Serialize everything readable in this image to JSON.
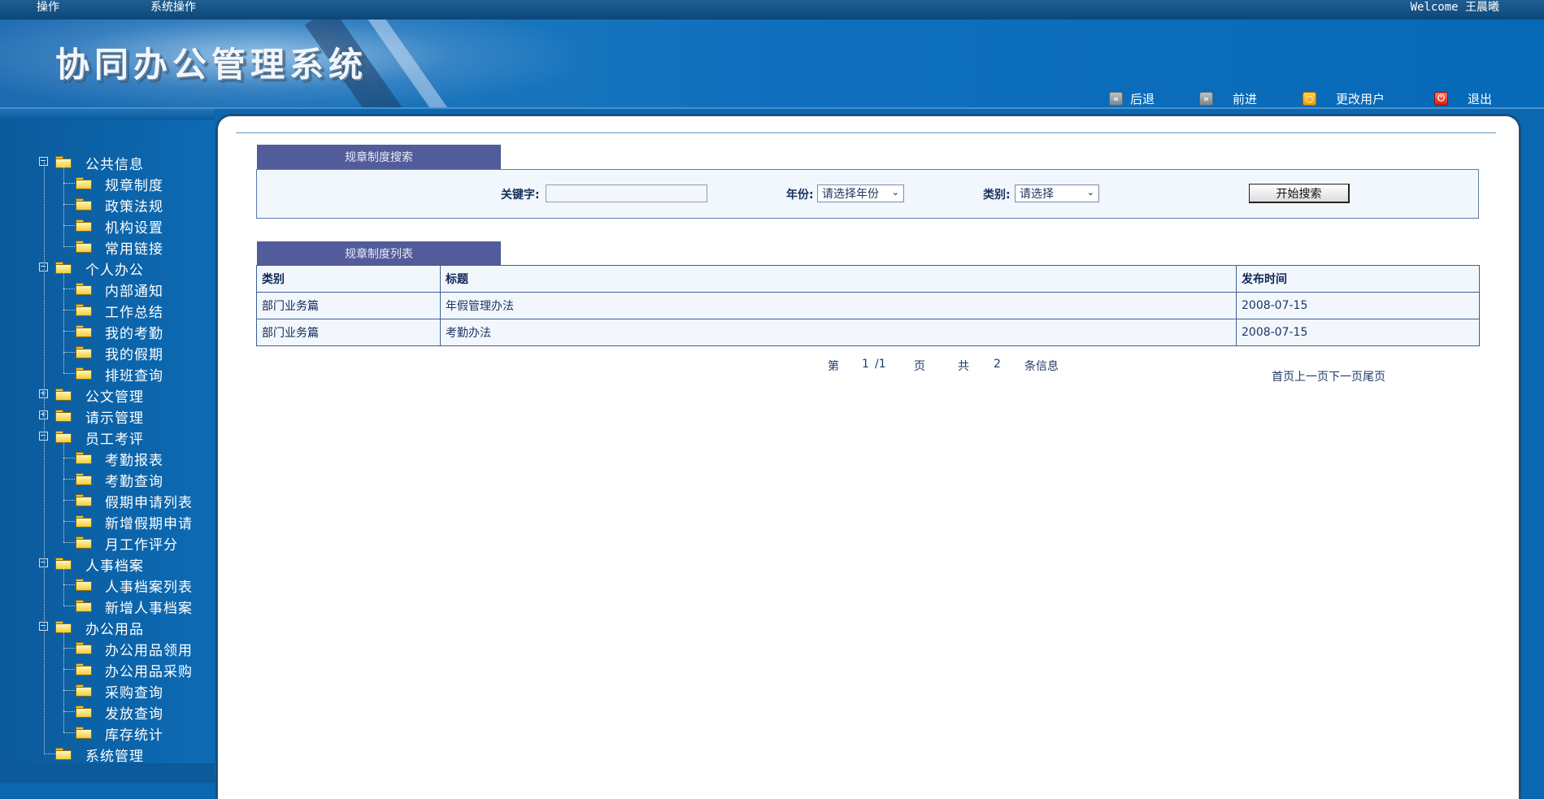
{
  "topbar": {
    "item1": "操作",
    "item2": "系统操作",
    "welcome": "Welcome  王晨曦"
  },
  "banner": {
    "title": "协同办公管理系统"
  },
  "toolbar": {
    "back": "后退",
    "forward": "前进",
    "change_user": "更改用户",
    "logout": "退出"
  },
  "sidebar": {
    "groups": [
      {
        "label": "公共信息",
        "expanded": true,
        "items": [
          "规章制度",
          "政策法规",
          "机构设置",
          "常用链接"
        ]
      },
      {
        "label": "个人办公",
        "expanded": true,
        "items": [
          "内部通知",
          "工作总结",
          "我的考勤",
          "我的假期",
          "排班查询"
        ]
      },
      {
        "label": "公文管理",
        "expanded": false,
        "items": []
      },
      {
        "label": "请示管理",
        "expanded": false,
        "items": []
      },
      {
        "label": "员工考评",
        "expanded": true,
        "items": [
          "考勤报表",
          "考勤查询",
          "假期申请列表",
          "新增假期申请",
          "月工作评分"
        ]
      },
      {
        "label": "人事档案",
        "expanded": true,
        "items": [
          "人事档案列表",
          "新增人事档案"
        ]
      },
      {
        "label": "办公用品",
        "expanded": true,
        "items": [
          "办公用品领用",
          "办公用品采购",
          "采购查询",
          "发放查询",
          "库存统计"
        ]
      },
      {
        "label": "系统管理",
        "expanded": false,
        "items": []
      }
    ]
  },
  "search": {
    "tab": "规章制度搜索",
    "keyword_label": "关键字:",
    "keyword_value": "",
    "year_label": "年份:",
    "year_selected": "请选择年份",
    "category_label": "类别:",
    "category_selected": "请选择",
    "submit": "开始搜索"
  },
  "list": {
    "tab": "规章制度列表",
    "columns": [
      "类别",
      "标题",
      "发布时间"
    ],
    "rows": [
      [
        "部门业务篇",
        "年假管理办法",
        "2008-07-15"
      ],
      [
        "部门业务篇",
        "考勤办法",
        "2008-07-15"
      ]
    ]
  },
  "pager": {
    "page_prefix": "第",
    "page_current": "1",
    "page_total": "/1",
    "page_suffix": "页",
    "total_prefix": "共",
    "total_count": "2",
    "total_suffix": "条信息",
    "links": "首页上一页下一页尾页"
  }
}
